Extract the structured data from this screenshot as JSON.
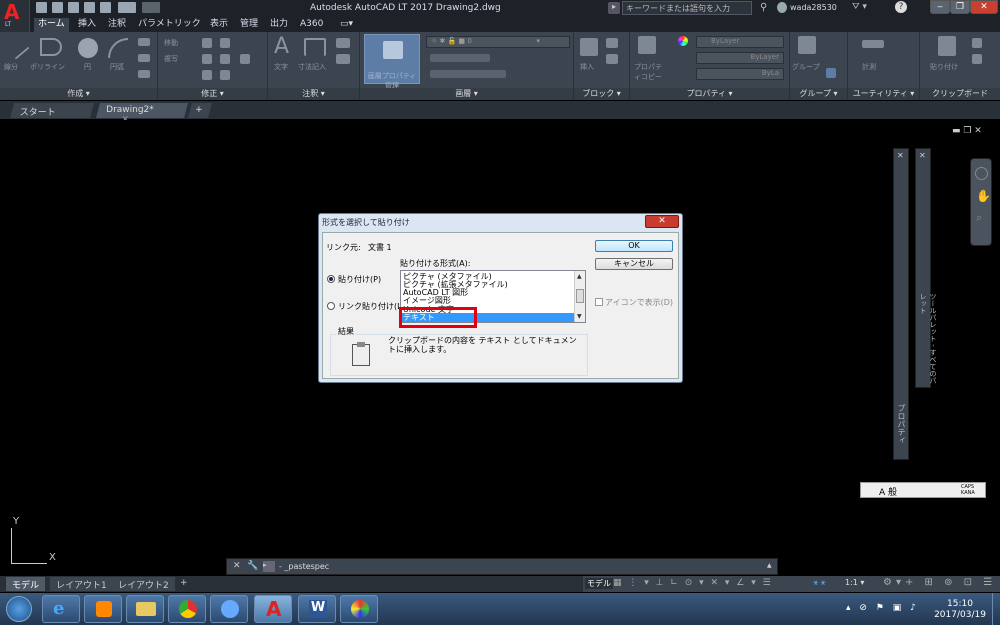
{
  "app": {
    "title": "Autodesk AutoCAD LT 2017    Drawing2.dwg",
    "logo_letter": "A",
    "logo_sub": "LT",
    "search_placeholder": "キーワードまたは語句を入力",
    "user": "wada28530",
    "accent": "#e22222"
  },
  "ribbon_tabs": [
    "ホーム",
    "挿入",
    "注釈",
    "パラメトリック",
    "表示",
    "管理",
    "出力",
    "A360"
  ],
  "ribbon_panels": [
    {
      "title": "作成 ▾",
      "tools": [
        "線分",
        "ポリライン",
        "円",
        "円弧"
      ]
    },
    {
      "title": "修正 ▾",
      "tools": [
        "移動",
        "複写"
      ]
    },
    {
      "title": "注釈 ▾",
      "tools": [
        "文字",
        "寸法記入"
      ]
    },
    {
      "title": "画層 ▾",
      "tools": [
        "画層プロパティ管理"
      ]
    },
    {
      "title": "ブロック ▾",
      "tools": [
        "挿入"
      ]
    },
    {
      "title": "プロパティ ▾",
      "tools": [
        "プロパティコピー"
      ],
      "props": [
        "ByLayer",
        "ByLayer",
        "ByLa"
      ]
    },
    {
      "title": "グループ ▾",
      "tools": [
        "グループ"
      ]
    },
    {
      "title": "ユーティリティ ▾",
      "tools": [
        "計測"
      ]
    },
    {
      "title": "クリップボード",
      "tools": [
        "貼り付け"
      ]
    }
  ],
  "doc_tabs": {
    "start": "スタート",
    "drawing": "Drawing2*",
    "add": "+"
  },
  "dialog": {
    "title": "形式を選択して貼り付け",
    "source_label": "リンク元:",
    "source_value": "文書 1",
    "format_label": "貼り付ける形式(A):",
    "paste_option": "貼り付け(P)",
    "link_option": "リンク貼り付け(L)",
    "formats": [
      "ピクチャ (メタファイル)",
      "ピクチャ (拡張メタファイル)",
      "AutoCAD LT 図形",
      "イメージ図形",
      "Unicode 文字",
      "テキスト"
    ],
    "selected_index": 5,
    "ok": "OK",
    "cancel": "キャンセル",
    "icon_option": "アイコンで表示(D)",
    "result_label": "結果",
    "result_text": "クリップボードの内容を テキスト としてドキュメントに挿入します。"
  },
  "side_palettes": {
    "properties": "プロパティ",
    "toolpalette": "ツールパレット - すべてのパレット"
  },
  "command_line": {
    "text": "- _pastespec"
  },
  "axis": {
    "y": "Y",
    "x": "X"
  },
  "layout_tabs": [
    "モデル",
    "レイアウト1",
    "レイアウト2",
    "+"
  ],
  "status": {
    "model": "モデル",
    "scale": "1:1 ▾"
  },
  "ime": {
    "mode": "A 般",
    "caps": "CAPS",
    "kana": "KANA"
  },
  "clock": {
    "time": "15:10",
    "date": "2017/03/19"
  }
}
